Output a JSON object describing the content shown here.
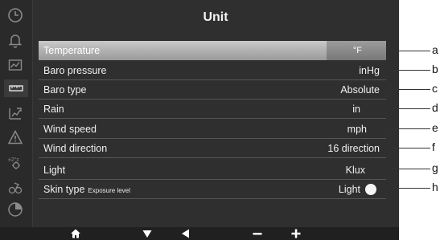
{
  "title": "Unit",
  "rows": [
    {
      "label": "Temperature",
      "sub": "",
      "value": "°F"
    },
    {
      "label": "Baro pressure",
      "sub": "",
      "value": "inHg"
    },
    {
      "label": "Baro type",
      "sub": "",
      "value": "Absolute"
    },
    {
      "label": "Rain",
      "sub": "",
      "value": "in"
    },
    {
      "label": "Wind speed",
      "sub": "",
      "value": "mph"
    },
    {
      "label": "Wind direction",
      "sub": "",
      "value": "16 direction"
    },
    {
      "label": "Light",
      "sub": "",
      "value": "Klux"
    },
    {
      "label": "Skin type",
      "sub": "Exposure level",
      "value": "Light"
    }
  ],
  "callouts": [
    "a",
    "b",
    "c",
    "d",
    "e",
    "f",
    "g",
    "h"
  ],
  "sidebar_icons": [
    "clock-icon",
    "bell-icon",
    "chart-icon",
    "ruler-icon",
    "calibration-icon",
    "warning-icon",
    "temperature-offset-icon",
    "sensor-icon",
    "pie-chart-icon"
  ],
  "bottom_nav": [
    "home-icon",
    "down-arrow-icon",
    "left-arrow-icon",
    "minus-icon",
    "plus-icon"
  ],
  "colors": {
    "screen": "#2f2f2f",
    "selected": "#b5b5b5",
    "text": "#f0f0f0"
  }
}
